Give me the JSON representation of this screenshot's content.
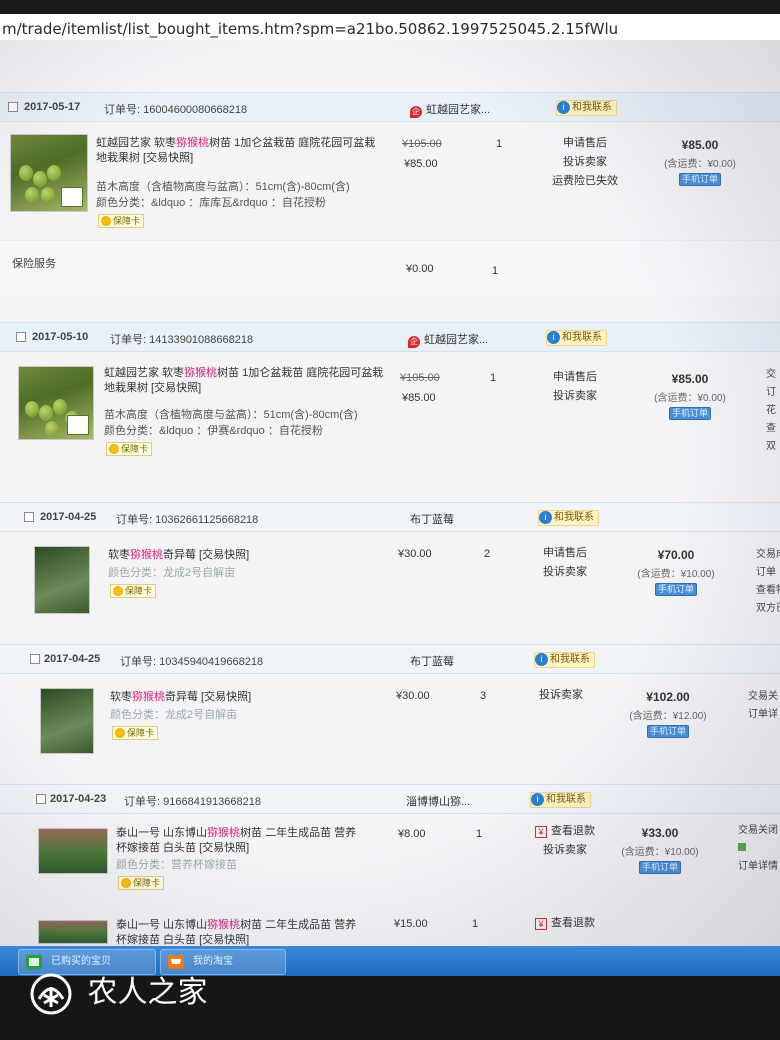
{
  "browser": {
    "url": "m/trade/itemlist/list_bought_items.htm?spm=a21bo.50862.1997525045.2.15fWlu"
  },
  "orders": [
    {
      "date": "2017-05-17",
      "order_no_label": "订单号: 16004600080668218",
      "shop": "虹越园艺家...",
      "contact": "和我联系",
      "item": {
        "title_pre": "虹越园艺家 软枣",
        "title_hl": "猕猴桃",
        "title_post": "树苗 1加仑盆栽苗 庭院花园可盆栽地栽果树 [交易快照]",
        "attr1": "苗木高度（含植物高度与盆高）：51cm(含)-80cm(含)",
        "attr2": "颜色分类：&ldquo ：库库瓦&rdquo ：自花授粉",
        "guarantee": "保障卡",
        "price_old": "¥105.00",
        "price": "¥85.00",
        "qty": "1",
        "ops": [
          "申请售后",
          "投诉卖家",
          "运费险已失效"
        ],
        "total": "¥85.00",
        "shipping": "(含运费：¥0.00)",
        "button": "手机订单"
      },
      "insurance": {
        "label": "保险服务",
        "price": "¥0.00",
        "qty": "1"
      }
    },
    {
      "date": "2017-05-10",
      "order_no_label": "订单号: 14133901088668218",
      "shop": "虹越园艺家...",
      "contact": "和我联系",
      "item": {
        "title_pre": "虹越园艺家 软枣",
        "title_hl": "猕猴桃",
        "title_post": "树苗 1加仑盆栽苗 庭院花园可盆栽地栽果树 [交易快照]",
        "attr1": "苗木高度（含植物高度与盆高）：51cm(含)-80cm(含)",
        "attr2": "颜色分类：&ldquo ：伊赛&rdquo ：自花授粉",
        "guarantee": "保障卡",
        "price_old": "¥105.00",
        "price": "¥85.00",
        "qty": "1",
        "ops": [
          "申请售后",
          "投诉卖家"
        ],
        "total": "¥85.00",
        "shipping": "(含运费：¥0.00)",
        "button": "手机订单",
        "status": [
          "交",
          "订",
          "花",
          "查",
          "双"
        ]
      }
    },
    {
      "date": "2017-04-25",
      "order_no_label": "订单号: 10362661125668218",
      "shop": "布丁蓝莓",
      "contact": "和我联系",
      "item": {
        "title_pre": "软枣",
        "title_hl": "猕猴桃",
        "title_post": "奇异莓 [交易快照]",
        "attr1": "颜色分类：龙成2号自解亩",
        "guarantee": "保障卡",
        "price": "¥30.00",
        "qty": "2",
        "ops": [
          "申请售后",
          "投诉卖家"
        ],
        "total": "¥70.00",
        "shipping": "(含运费：¥10.00)",
        "button": "手机订单",
        "status": [
          "交易成",
          "订单",
          "查看物",
          "双方已"
        ]
      }
    },
    {
      "date": "2017-04-25",
      "order_no_label": "订单号: 10345940419668218",
      "shop": "布丁蓝莓",
      "contact": "和我联系",
      "item": {
        "title_pre": "软枣",
        "title_hl": "猕猴桃",
        "title_post": "奇异莓 [交易快照]",
        "attr1": "颜色分类：龙成2号自解亩",
        "guarantee": "保障卡",
        "price": "¥30.00",
        "qty": "3",
        "ops": [
          "投诉卖家"
        ],
        "total": "¥102.00",
        "shipping": "(含运费：¥12.00)",
        "button": "手机订单",
        "status": [
          "交易关",
          "订单详"
        ]
      }
    },
    {
      "date": "2017-04-23",
      "order_no_label": "订单号: 9166841913668218",
      "shop": "淄博博山猕...",
      "contact": "和我联系",
      "item": {
        "title_pre": "泰山一号 山东博山",
        "title_hl": "猕猴桃",
        "title_post": "树苗 二年生成品苗 营养杯嫁接苗 白头苗 [交易快照]",
        "attr1": "颜色分类：营养杯嫁接苗",
        "guarantee": "保障卡",
        "price": "¥8.00",
        "qty": "1",
        "ops": [
          "查看退款",
          "投诉卖家"
        ],
        "total": "¥33.00",
        "shipping": "(含运费：¥10.00)",
        "button": "手机订单",
        "status": [
          "交易关闭",
          "订单详情"
        ]
      },
      "item2": {
        "title_pre": "泰山一号 山东博山",
        "title_hl": "猕猴桃",
        "title_post": "树苗 二年生成品苗 营养杯嫁接苗 白头苗 [交易快照]",
        "price": "¥15.00",
        "qty": "1",
        "op": "查看退款"
      }
    }
  ],
  "taskbar": {
    "items": [
      "已购买的宝贝",
      "我的淘宝"
    ]
  },
  "watermark": {
    "text": "农人之家"
  }
}
